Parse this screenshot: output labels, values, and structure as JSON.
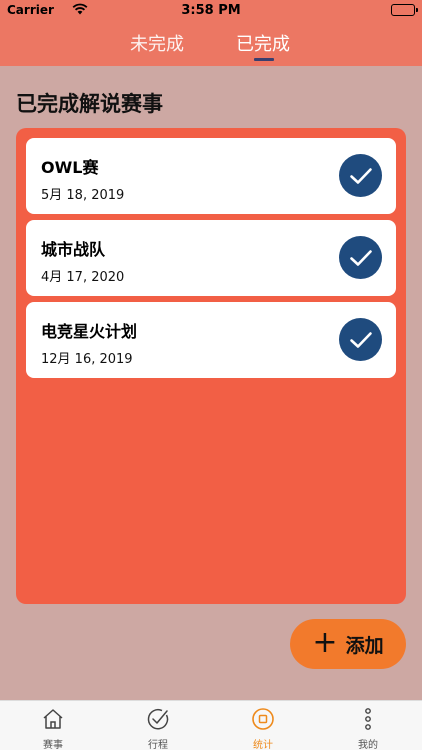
{
  "status": {
    "carrier": "Carrier",
    "time": "3:58 PM"
  },
  "tabs": [
    {
      "label": "未完成",
      "active": false
    },
    {
      "label": "已完成",
      "active": true
    }
  ],
  "section_title": "已完成解说赛事",
  "events": [
    {
      "name": "OWL赛",
      "date": "5月 18, 2019",
      "done": true
    },
    {
      "name": "城市战队",
      "date": "4月 17, 2020",
      "done": true
    },
    {
      "name": "电竞星火计划",
      "date": "12月 16, 2019",
      "done": true
    }
  ],
  "add_button": {
    "icon": "plus-icon",
    "label": "添加"
  },
  "tabbar": [
    {
      "label": "赛事",
      "icon": "home-icon"
    },
    {
      "label": "行程",
      "icon": "clock-check-icon"
    },
    {
      "label": "统计",
      "icon": "stats-circle-icon",
      "active": true
    },
    {
      "label": "我的",
      "icon": "more-dots-icon"
    }
  ],
  "colors": {
    "header": "#ec7763",
    "background": "#cda8a3",
    "panel": "#f25f45",
    "check": "#1f4b7e",
    "add_button": "#f27a2c",
    "tab_active": "#ee8a1c"
  }
}
